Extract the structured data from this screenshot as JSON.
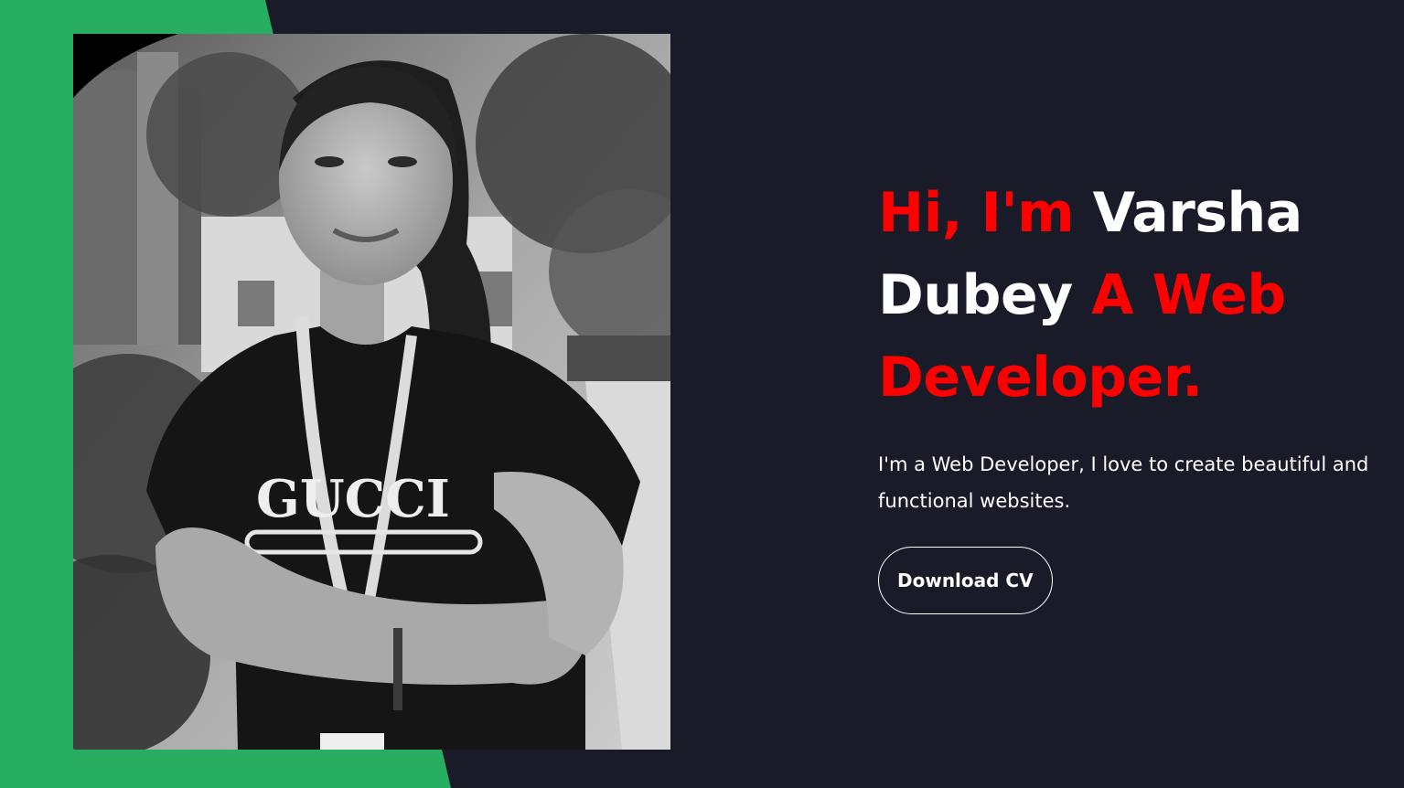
{
  "hero": {
    "greeting": "Hi, I'm",
    "name_first": "Varsha",
    "name_last": "Dubey",
    "role_prefix": "A Web",
    "role_suffix": "Developer.",
    "description": "I'm a Web Developer, I love to create beautiful and functional websites.",
    "cta_label": "Download CV",
    "shirt_text": "GUCCI"
  },
  "colors": {
    "background": "#1a1b29",
    "accent_green": "#27ae60",
    "accent_red": "#ff0000",
    "text": "#ffffff"
  }
}
